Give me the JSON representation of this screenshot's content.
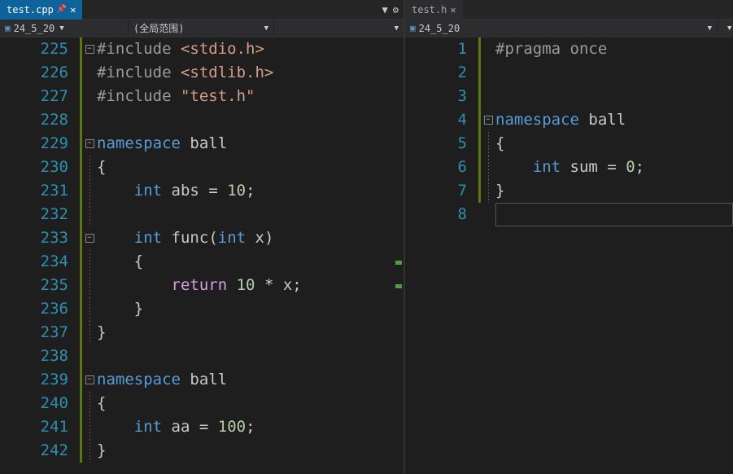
{
  "panes": {
    "left": {
      "tab": {
        "name": "test.cpp",
        "pinned": true,
        "close": "✕"
      },
      "tab_controls": {
        "dropdown": "▼",
        "gear": "⚙"
      },
      "nav": {
        "project": "24_5_20",
        "scope": "(全局范围)"
      },
      "startLine": 225,
      "lines": [
        {
          "n": 225,
          "fold": "-",
          "change": true,
          "code": [
            {
              "t": "#include",
              "c": "c-include"
            },
            {
              "t": " "
            },
            {
              "t": "<stdio.h>",
              "c": "c-header"
            }
          ]
        },
        {
          "n": 226,
          "change": true,
          "code": [
            {
              "t": "#include",
              "c": "c-include"
            },
            {
              "t": " "
            },
            {
              "t": "<stdlib.h>",
              "c": "c-header"
            }
          ]
        },
        {
          "n": 227,
          "change": true,
          "code": [
            {
              "t": "#include",
              "c": "c-include"
            },
            {
              "t": " "
            },
            {
              "t": "\"test.h\"",
              "c": "c-header"
            }
          ]
        },
        {
          "n": 228,
          "change": true,
          "code": []
        },
        {
          "n": 229,
          "fold": "-",
          "change": true,
          "code": [
            {
              "t": "namespace",
              "c": "c-keyword"
            },
            {
              "t": " "
            },
            {
              "t": "ball",
              "c": "c-ident"
            }
          ]
        },
        {
          "n": 230,
          "guide": true,
          "change": true,
          "code": [
            {
              "t": "{",
              "c": "c-punc"
            }
          ]
        },
        {
          "n": 231,
          "guide": true,
          "change": true,
          "code": [
            {
              "t": "    "
            },
            {
              "t": "int",
              "c": "c-type"
            },
            {
              "t": " "
            },
            {
              "t": "abs",
              "c": "c-ident"
            },
            {
              "t": " = "
            },
            {
              "t": "10",
              "c": "c-num"
            },
            {
              "t": ";",
              "c": "c-punc"
            }
          ]
        },
        {
          "n": 232,
          "guide": true,
          "change": true,
          "code": []
        },
        {
          "n": 233,
          "fold": "-",
          "guide": false,
          "change": true,
          "code": [
            {
              "t": "    "
            },
            {
              "t": "int",
              "c": "c-type"
            },
            {
              "t": " "
            },
            {
              "t": "func",
              "c": "c-func"
            },
            {
              "t": "(",
              "c": "c-punc"
            },
            {
              "t": "int",
              "c": "c-type"
            },
            {
              "t": " "
            },
            {
              "t": "x",
              "c": "c-ident"
            },
            {
              "t": ")",
              "c": "c-punc"
            }
          ]
        },
        {
          "n": 234,
          "guide": true,
          "change": true,
          "code": [
            {
              "t": "    {",
              "c": "c-punc"
            }
          ]
        },
        {
          "n": 235,
          "guide": true,
          "change": true,
          "code": [
            {
              "t": "        "
            },
            {
              "t": "return",
              "c": "c-return"
            },
            {
              "t": " "
            },
            {
              "t": "10",
              "c": "c-num"
            },
            {
              "t": " * "
            },
            {
              "t": "x",
              "c": "c-ident"
            },
            {
              "t": ";",
              "c": "c-punc"
            }
          ]
        },
        {
          "n": 236,
          "guide": true,
          "change": true,
          "code": [
            {
              "t": "    }",
              "c": "c-punc"
            }
          ]
        },
        {
          "n": 237,
          "guide": true,
          "change": true,
          "code": [
            {
              "t": "}",
              "c": "c-punc"
            }
          ]
        },
        {
          "n": 238,
          "change": true,
          "code": []
        },
        {
          "n": 239,
          "fold": "-",
          "change": true,
          "code": [
            {
              "t": "namespace",
              "c": "c-keyword"
            },
            {
              "t": " "
            },
            {
              "t": "ball",
              "c": "c-ident"
            }
          ]
        },
        {
          "n": 240,
          "guide": true,
          "change": true,
          "code": [
            {
              "t": "{",
              "c": "c-punc"
            }
          ]
        },
        {
          "n": 241,
          "guide": true,
          "change": true,
          "code": [
            {
              "t": "    "
            },
            {
              "t": "int",
              "c": "c-type"
            },
            {
              "t": " "
            },
            {
              "t": "aa",
              "c": "c-ident"
            },
            {
              "t": " = "
            },
            {
              "t": "100",
              "c": "c-num"
            },
            {
              "t": ";",
              "c": "c-punc"
            }
          ]
        },
        {
          "n": 242,
          "guide": true,
          "change": true,
          "code": [
            {
              "t": "}",
              "c": "c-punc"
            }
          ]
        }
      ]
    },
    "right": {
      "tab": {
        "name": "test.h",
        "close": "✕"
      },
      "nav": {
        "project": "24_5_20"
      },
      "startLine": 1,
      "lines": [
        {
          "n": 1,
          "change": true,
          "code": [
            {
              "t": "#pragma",
              "c": "c-pragma"
            },
            {
              "t": " "
            },
            {
              "t": "once",
              "c": "c-pragma"
            }
          ]
        },
        {
          "n": 2,
          "change": true,
          "code": []
        },
        {
          "n": 3,
          "change": true,
          "code": []
        },
        {
          "n": 4,
          "fold": "-",
          "change": true,
          "code": [
            {
              "t": "namespace",
              "c": "c-keyword"
            },
            {
              "t": " "
            },
            {
              "t": "ball",
              "c": "c-ident"
            }
          ]
        },
        {
          "n": 5,
          "guide": true,
          "change": true,
          "code": [
            {
              "t": "{",
              "c": "c-punc"
            }
          ]
        },
        {
          "n": 6,
          "guide": true,
          "change": true,
          "code": [
            {
              "t": "    "
            },
            {
              "t": "int",
              "c": "c-type"
            },
            {
              "t": " "
            },
            {
              "t": "sum",
              "c": "c-ident"
            },
            {
              "t": " = "
            },
            {
              "t": "0",
              "c": "c-num"
            },
            {
              "t": ";",
              "c": "c-punc"
            }
          ]
        },
        {
          "n": 7,
          "guide": true,
          "change": true,
          "code": [
            {
              "t": "}",
              "c": "c-punc"
            }
          ]
        },
        {
          "n": 8,
          "caret": true,
          "code": []
        }
      ]
    }
  }
}
